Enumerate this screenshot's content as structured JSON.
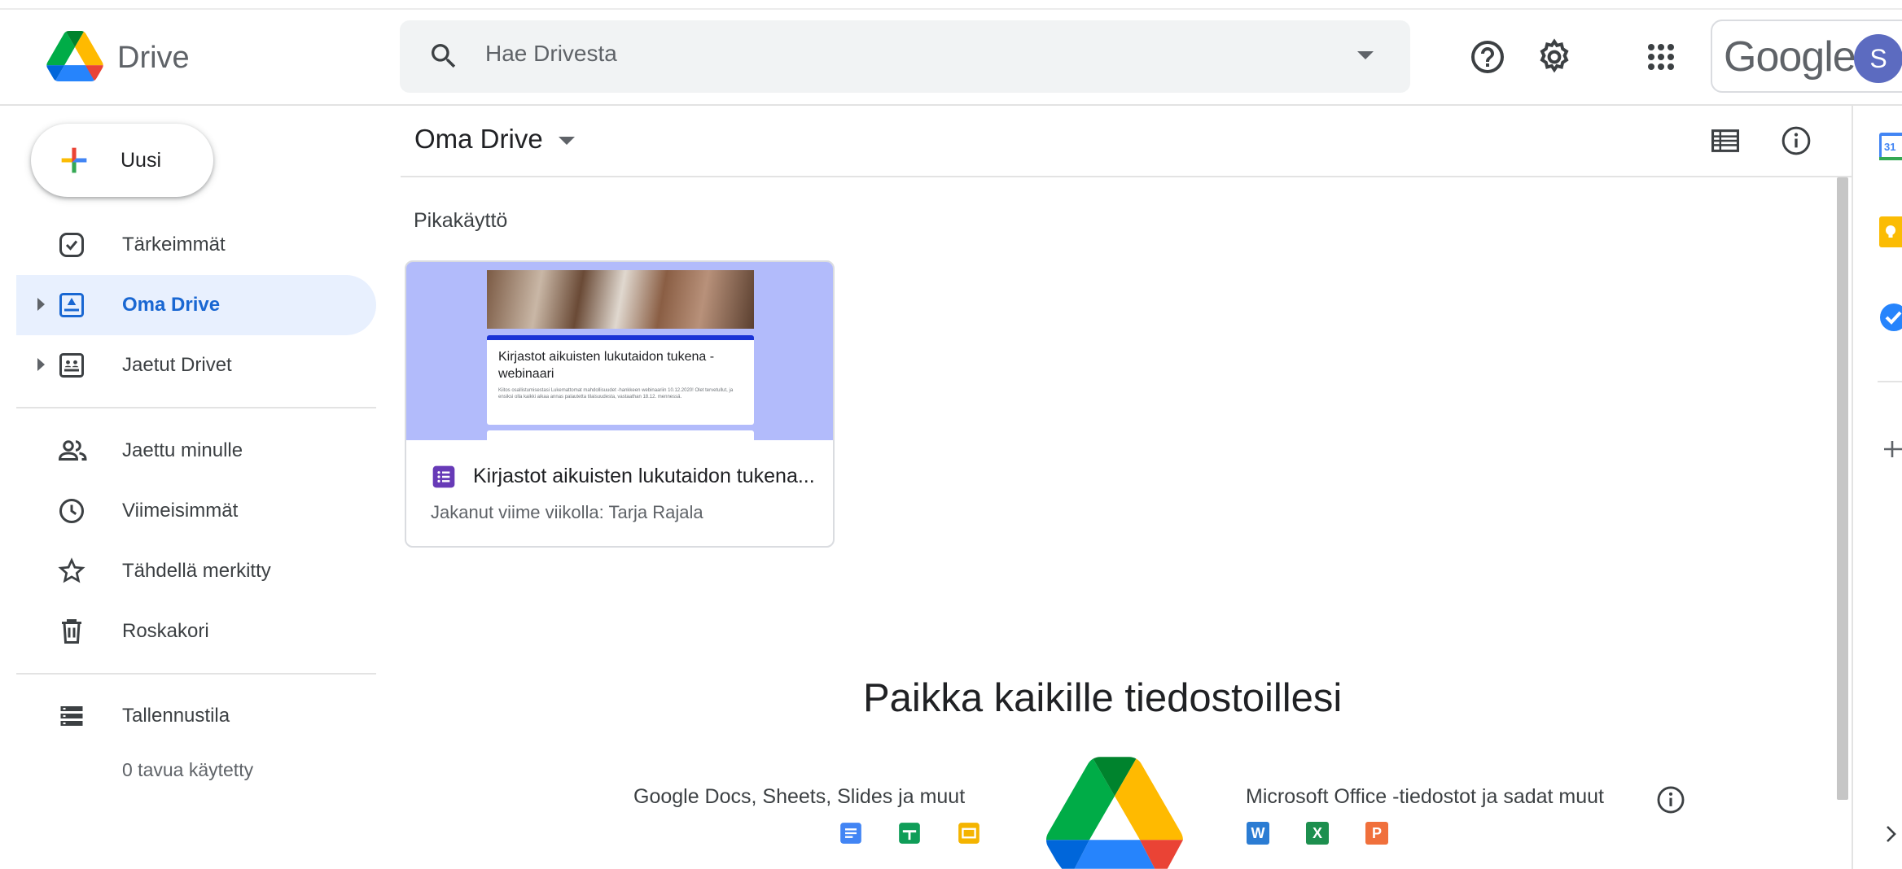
{
  "header": {
    "app_title": "Drive",
    "search_placeholder": "Hae Drivesta",
    "google_word": "Google",
    "avatar_initial": "S"
  },
  "sidebar": {
    "new_label": "Uusi",
    "items": [
      {
        "label": "Tärkeimmät",
        "icon": "priority-icon"
      },
      {
        "label": "Oma Drive",
        "icon": "my-drive-icon",
        "active": true
      },
      {
        "label": "Jaetut Drivet",
        "icon": "shared-drives-icon"
      },
      {
        "label": "Jaettu minulle",
        "icon": "shared-with-me-icon"
      },
      {
        "label": "Viimeisimmät",
        "icon": "clock-icon"
      },
      {
        "label": "Tähdellä merkitty",
        "icon": "star-icon"
      },
      {
        "label": "Roskakori",
        "icon": "trash-icon"
      },
      {
        "label": "Tallennustila",
        "icon": "storage-icon"
      }
    ],
    "storage_used": "0 tavua käytetty"
  },
  "main": {
    "title": "Oma Drive",
    "quick_access_label": "Pikakäyttö",
    "quick_card": {
      "thumb_title": "Kirjastot aikuisten lukutaidon tukena - webinaari",
      "thumb_desc": "Kiitos osallistumisestasi Lukemattomat mahdollisuudet -hankkeen webinaariin 10.12.2020! Olet tervetullut, ja ensiksi olla kaikki aikaa annas palautetta tilaisuudesta, vastaathan 18.12. mennessä.",
      "file_name": "Kirjastot aikuisten lukutaidon tukena...",
      "shared_info": "Jakanut viime viikolla: Tarja Rajala"
    },
    "empty_state": {
      "title": "Paikka kaikille tiedostoillesi",
      "docs_label": "Google Docs, Sheets, Slides ja muut",
      "ms_label": "Microsoft Office -tiedostot ja sadat muut",
      "ms_icons": [
        "W",
        "X",
        "P"
      ]
    }
  },
  "colors": {
    "accent": "#1967d2",
    "active_bg": "#e8f0fe",
    "forms_purple": "#673ab7"
  }
}
